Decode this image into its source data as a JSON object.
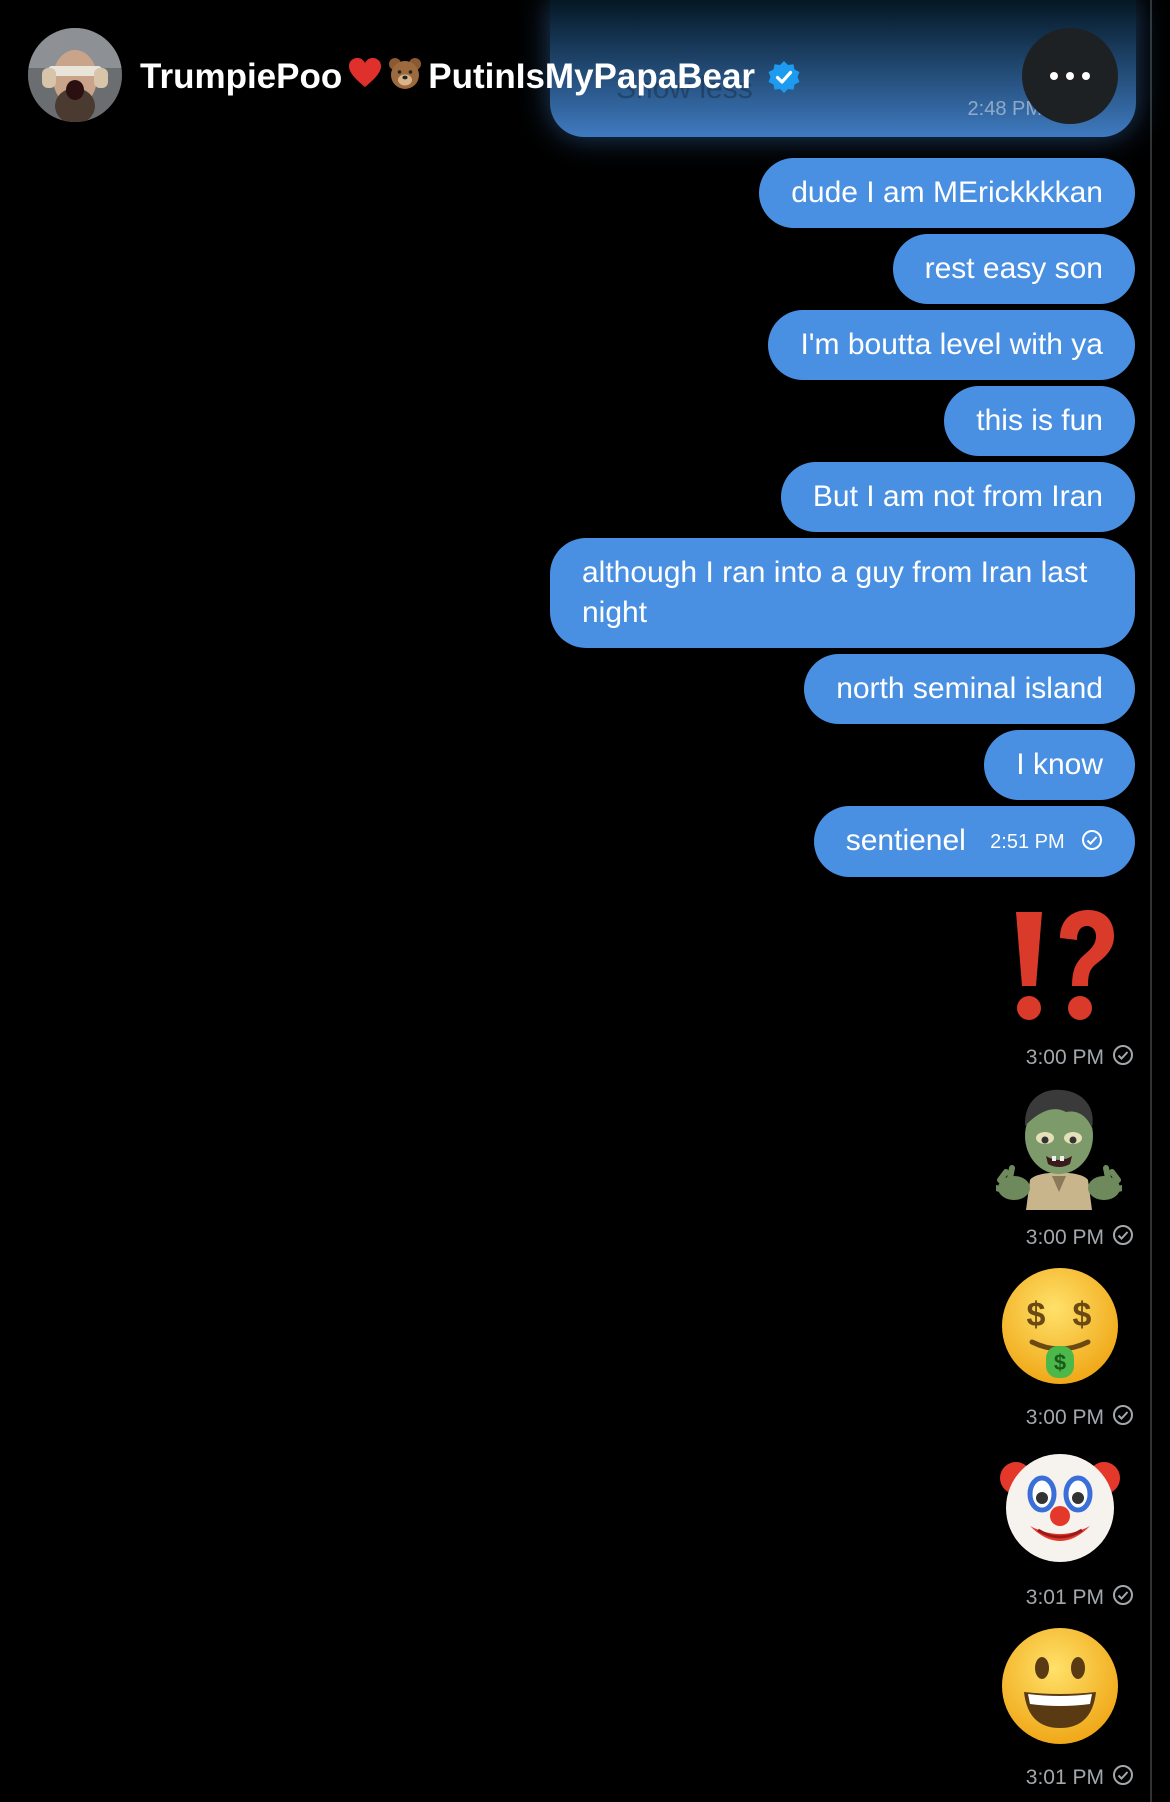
{
  "header": {
    "name": "TrumpiePoo",
    "name_suffix": "PutinIsMyPapaBear",
    "heart_emoji": "❤️",
    "bear_emoji": "🐻",
    "verified_icon": "verified-badge-icon",
    "more_icon": "ellipsis-icon"
  },
  "top_bubble": {
    "show_less": "Show less",
    "time": "2:48 PM"
  },
  "messages": [
    {
      "text": "dude I am MErickkkkan"
    },
    {
      "text": "rest easy son"
    },
    {
      "text": "I'm boutta level with ya"
    },
    {
      "text": "this is fun"
    },
    {
      "text": "But I am not from Iran"
    },
    {
      "text": "although I ran into a guy from Iran last night"
    },
    {
      "text": "north seminal island"
    },
    {
      "text": "I know"
    },
    {
      "text": "sentienel",
      "time": "2:51 PM"
    }
  ],
  "emoji_messages": [
    {
      "emoji": "exclamation-question-mark",
      "time": "3:00 PM"
    },
    {
      "emoji": "zombie",
      "time": "3:00 PM"
    },
    {
      "emoji": "money-mouth-face",
      "time": "3:00 PM"
    },
    {
      "emoji": "clown-face",
      "time": "3:01 PM"
    },
    {
      "emoji": "grinning-face",
      "time": "3:01 PM"
    }
  ],
  "colors": {
    "bubble": "#4a90e2",
    "background": "#000000",
    "verified": "#1d9bf0",
    "timestamp": "#a3a8ad"
  }
}
